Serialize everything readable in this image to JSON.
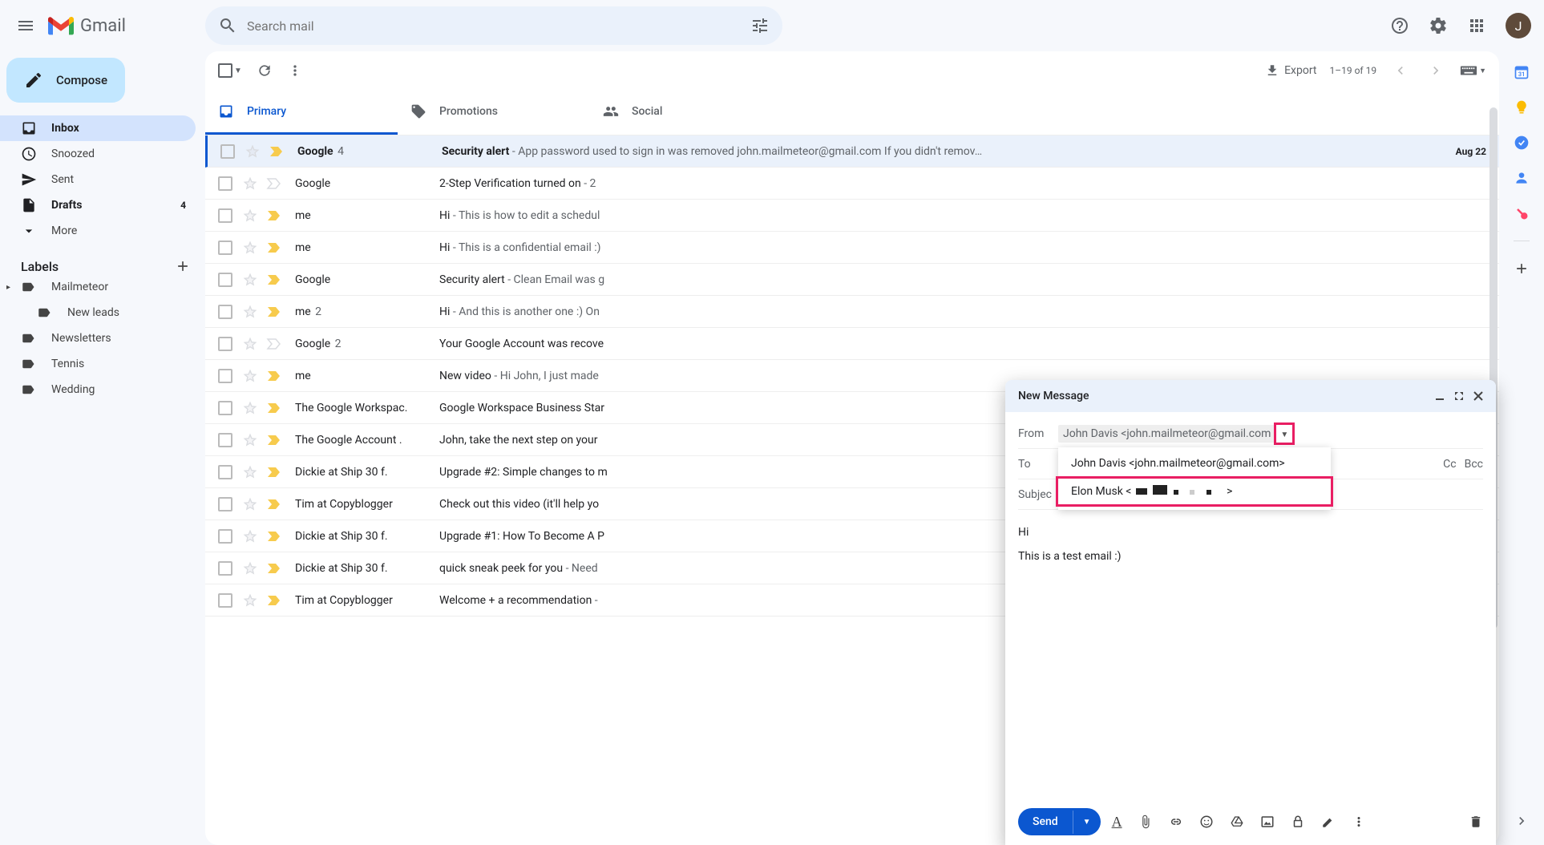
{
  "header": {
    "app_name": "Gmail",
    "search_placeholder": "Search mail",
    "avatar_letter": "J"
  },
  "compose_button": "Compose",
  "nav": [
    {
      "icon": "inbox",
      "label": "Inbox",
      "active": true,
      "bold": true,
      "count": ""
    },
    {
      "icon": "clock",
      "label": "Snoozed",
      "active": false,
      "bold": false,
      "count": ""
    },
    {
      "icon": "send",
      "label": "Sent",
      "active": false,
      "bold": false,
      "count": ""
    },
    {
      "icon": "draft",
      "label": "Drafts",
      "active": false,
      "bold": true,
      "count": "4"
    },
    {
      "icon": "more",
      "label": "More",
      "active": false,
      "bold": false,
      "count": ""
    }
  ],
  "labels_header": "Labels",
  "labels": [
    {
      "label": "Mailmeteor",
      "nested": false,
      "expandable": true
    },
    {
      "label": "New leads",
      "nested": true,
      "expandable": false
    },
    {
      "label": "Newsletters",
      "nested": false,
      "expandable": false
    },
    {
      "label": "Tennis",
      "nested": false,
      "expandable": false
    },
    {
      "label": "Wedding",
      "nested": false,
      "expandable": false
    }
  ],
  "toolbar": {
    "export_label": "Export",
    "page_info": "1–19 of 19"
  },
  "tabs": [
    {
      "label": "Primary",
      "active": true,
      "icon": "primary"
    },
    {
      "label": "Promotions",
      "active": false,
      "icon": "promo"
    },
    {
      "label": "Social",
      "active": false,
      "icon": "social"
    }
  ],
  "mails": [
    {
      "unread": true,
      "selected": true,
      "important": true,
      "sender": "Google",
      "count": "4",
      "subject": "Security alert",
      "snippet": " - App password used to sign in was removed john.mailmeteor@gmail.com If you didn't remov…",
      "date": "Aug 22"
    },
    {
      "unread": false,
      "selected": false,
      "important": false,
      "sender": "Google",
      "count": "",
      "subject": "2-Step Verification turned on",
      "snippet": " - 2",
      "date": ""
    },
    {
      "unread": false,
      "selected": false,
      "important": true,
      "sender": "me",
      "count": "",
      "subject": "Hi",
      "snippet": " - This is how to edit a schedul",
      "date": ""
    },
    {
      "unread": false,
      "selected": false,
      "important": true,
      "sender": "me",
      "count": "",
      "subject": "Hi",
      "snippet": " - This is a confidential email :)",
      "date": ""
    },
    {
      "unread": false,
      "selected": false,
      "important": true,
      "sender": "Google",
      "count": "",
      "subject": "Security alert",
      "snippet": " - Clean Email was g",
      "date": ""
    },
    {
      "unread": false,
      "selected": false,
      "important": true,
      "sender": "me",
      "count": "2",
      "subject": "Hi",
      "snippet": " - And this is another one :) On",
      "date": ""
    },
    {
      "unread": false,
      "selected": false,
      "important": false,
      "sender": "Google",
      "count": "2",
      "subject": "Your Google Account was recove",
      "snippet": "",
      "date": ""
    },
    {
      "unread": false,
      "selected": false,
      "important": true,
      "sender": "me",
      "count": "",
      "subject": "New video",
      "snippet": " - Hi John, I just made",
      "date": ""
    },
    {
      "unread": false,
      "selected": false,
      "important": true,
      "sender": "The Google Workspac.",
      "count": "",
      "subject": "Google Workspace Business Star",
      "snippet": "",
      "date": ""
    },
    {
      "unread": false,
      "selected": false,
      "important": true,
      "sender": "The Google Account .",
      "count": "",
      "subject": "John, take the next step on your",
      "snippet": "",
      "date": ""
    },
    {
      "unread": false,
      "selected": false,
      "important": true,
      "sender": "Dickie at Ship 30 f.",
      "count": "",
      "subject": "Upgrade #2: Simple changes to m",
      "snippet": "",
      "date": ""
    },
    {
      "unread": false,
      "selected": false,
      "important": true,
      "sender": "Tim at Copyblogger",
      "count": "",
      "subject": "Check out this video (it'll help yo",
      "snippet": "",
      "date": ""
    },
    {
      "unread": false,
      "selected": false,
      "important": true,
      "sender": "Dickie at Ship 30 f.",
      "count": "",
      "subject": "Upgrade #1: How To Become A P",
      "snippet": "",
      "date": ""
    },
    {
      "unread": false,
      "selected": false,
      "important": true,
      "sender": "Dickie at Ship 30 f.",
      "count": "",
      "subject": "quick sneak peek for you",
      "snippet": " - Need",
      "date": ""
    },
    {
      "unread": false,
      "selected": false,
      "important": true,
      "sender": "Tim at Copyblogger",
      "count": "",
      "subject": "Welcome + a recommendation",
      "snippet": " - ",
      "date": ""
    }
  ],
  "compose": {
    "title": "New Message",
    "from_label": "From",
    "from_value": "John Davis <john.mailmeteor@gmail.com",
    "to_label": "To",
    "subject_label": "Subjec",
    "cc_label": "Cc",
    "bcc_label": "Bcc",
    "from_options": [
      "John Davis <john.mailmeteor@gmail.com>",
      "Elon Musk <"
    ],
    "from_option_suffix": ">",
    "body_line1": "Hi",
    "body_line2": "This is a test email :)",
    "send_label": "Send"
  }
}
